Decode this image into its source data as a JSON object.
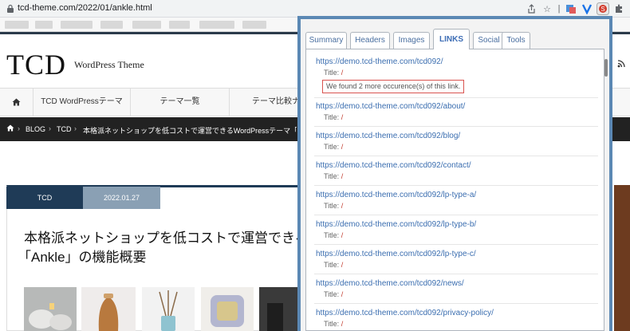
{
  "browser": {
    "url": "tcd-theme.com/2022/01/ankle.html"
  },
  "site": {
    "logo": "TCD",
    "logo_sub": "WordPress Theme",
    "nav": [
      "TCD WordPressテーマ",
      "テーマ一覧",
      "テーマ比較ナ"
    ],
    "breadcrumb": [
      "BLOG",
      "TCD",
      "本格派ネットショップを低コストで運営できるWordPressテーマ「Ankle」の"
    ],
    "article": {
      "category": "TCD",
      "date": "2022.01.27",
      "title_line1": "本格派ネットショップを低コストで運営できる",
      "title_line2": "「Ankle」の機能概要"
    }
  },
  "popup": {
    "tabs": [
      "Summary",
      "Headers",
      "Images",
      "LINKS",
      "Social",
      "Tools"
    ],
    "active_tab": "LINKS",
    "notice": "We found 2 more occurence(s) of this link.",
    "title_label": "Title:",
    "links": [
      {
        "url": "https://demo.tcd-theme.com/tcd092/",
        "title": "/"
      },
      {
        "url": "https://demo.tcd-theme.com/tcd092/about/",
        "title": "/"
      },
      {
        "url": "https://demo.tcd-theme.com/tcd092/blog/",
        "title": "/"
      },
      {
        "url": "https://demo.tcd-theme.com/tcd092/contact/",
        "title": "/"
      },
      {
        "url": "https://demo.tcd-theme.com/tcd092/lp-type-a/",
        "title": "/"
      },
      {
        "url": "https://demo.tcd-theme.com/tcd092/lp-type-b/",
        "title": "/"
      },
      {
        "url": "https://demo.tcd-theme.com/tcd092/lp-type-c/",
        "title": "/"
      },
      {
        "url": "https://demo.tcd-theme.com/tcd092/news/",
        "title": "/"
      },
      {
        "url": "https://demo.tcd-theme.com/tcd092/privacy-policy/",
        "title": "/"
      }
    ]
  },
  "colors": {
    "popup_frame": "#5b88b4",
    "link": "#3b6eb0",
    "title_value": "#c0392b",
    "notice_border": "#d9534f"
  }
}
